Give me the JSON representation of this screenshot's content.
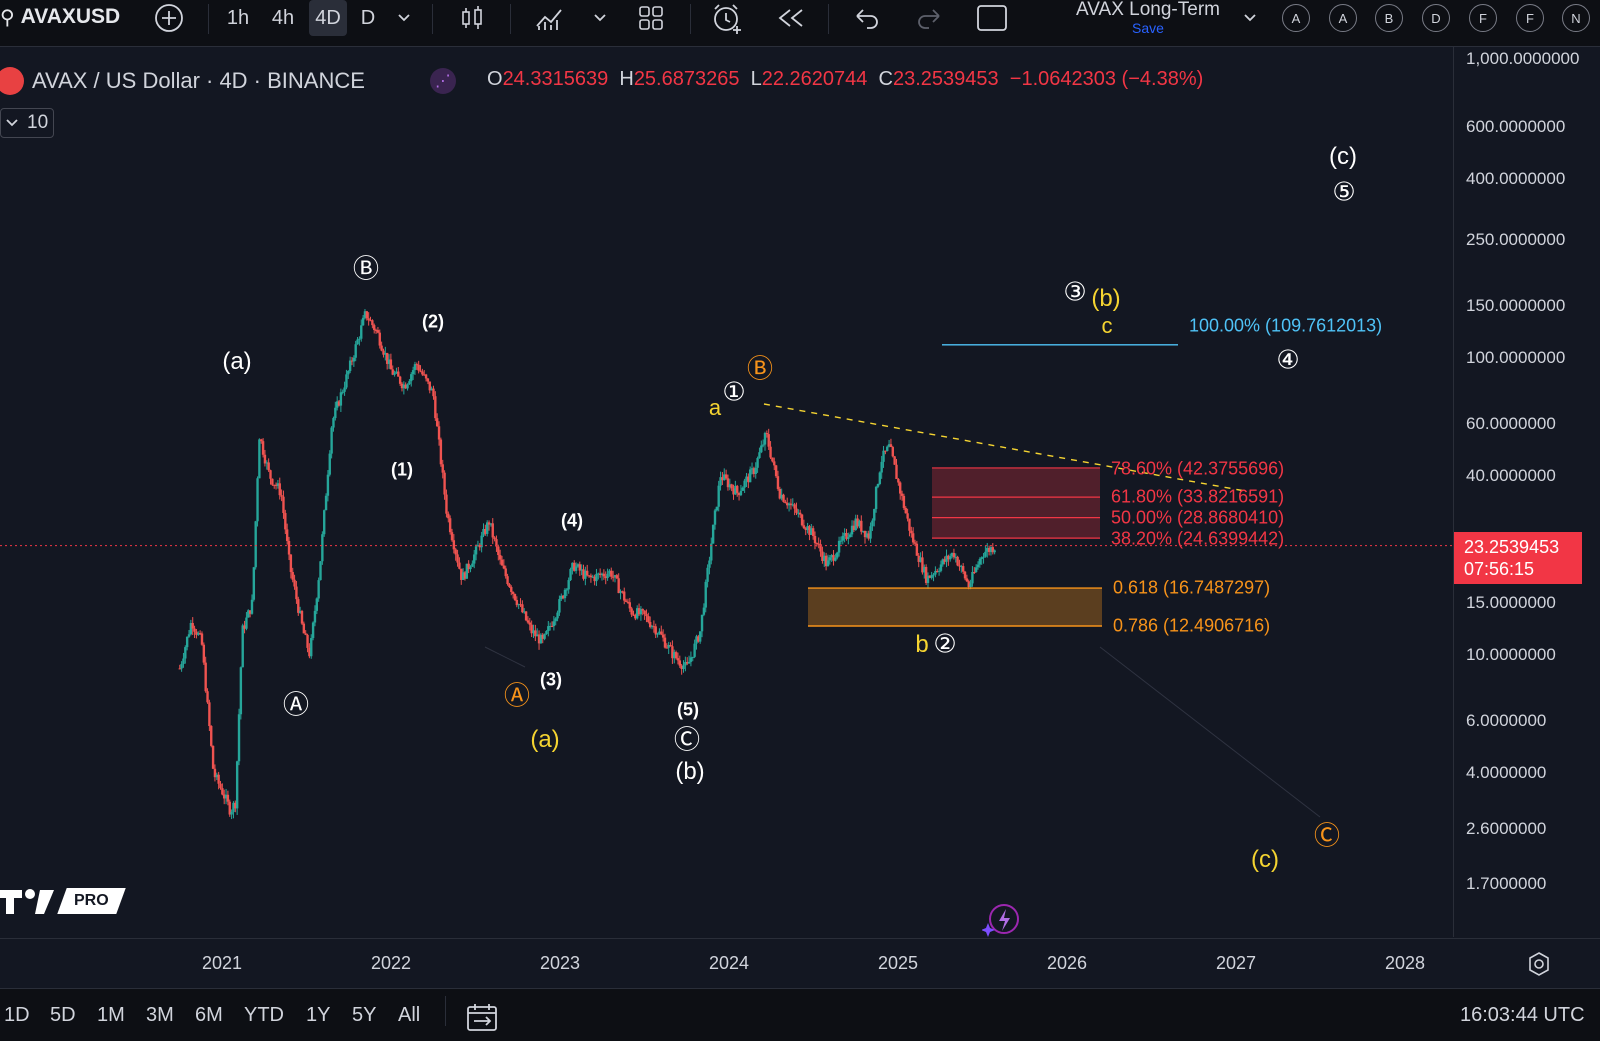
{
  "toolbar": {
    "symbol": "AVAXUSD",
    "intervals": [
      "1h",
      "4h",
      "4D",
      "D"
    ],
    "selected_interval": "4D",
    "layout_name": "AVAX Long-Term",
    "save_label": "Save",
    "alert_letters": [
      "A",
      "A",
      "B",
      "D",
      "F",
      "F",
      "N"
    ]
  },
  "legend": {
    "title": "AVAX / US Dollar · 4D · BINANCE",
    "o_label": "O",
    "o": "24.3315639",
    "h_label": "H",
    "h": "25.6873265",
    "l_label": "L",
    "l": "22.2620744",
    "c_label": "C",
    "c": "23.2539453",
    "change": "−1.0642303 (−4.38%)",
    "volume_indicator": "10"
  },
  "price_axis": {
    "labels": [
      "1,000.0000000",
      "600.0000000",
      "400.0000000",
      "250.0000000",
      "150.0000000",
      "100.0000000",
      "60.0000000",
      "40.0000000",
      "15.0000000",
      "10.0000000",
      "6.0000000",
      "4.0000000",
      "2.6000000",
      "1.7000000"
    ],
    "current_price": "23.2539453",
    "countdown": "07:56:15"
  },
  "time_axis": {
    "labels": [
      "2021",
      "2022",
      "2023",
      "2024",
      "2025",
      "2026",
      "2027",
      "2028"
    ]
  },
  "bottom_bar": {
    "ranges": [
      "1D",
      "5D",
      "1M",
      "3M",
      "6M",
      "YTD",
      "1Y",
      "5Y",
      "All"
    ],
    "clock": "16:03:44 UTC"
  },
  "fib_levels": {
    "upper": [
      "78.60% (42.3755696)",
      "61.80% (33.8216591)",
      "50.00% (28.8680410)",
      "38.20% (24.6399442)"
    ],
    "target": "100.00% (109.7612013)",
    "lower": [
      "0.618 (16.7487297)",
      "0.786 (12.4906716)"
    ]
  },
  "wave_labels": {
    "a_paren": "(a)",
    "B_circ": "Ⓑ",
    "w2": "(2)",
    "w1": "(1)",
    "w4": "(4)",
    "w3": "(3)",
    "w5": "(5)",
    "A_circ": "Ⓐ",
    "A_orange": "Ⓐ",
    "a_yellow": "(a)",
    "C_circ": "Ⓒ",
    "b_paren": "(b)",
    "a_small": "a",
    "one_circ": "①",
    "B_orange": "Ⓑ",
    "three_circ": "③",
    "b_yellow": "(b)",
    "c_small": "c",
    "b_small": "b",
    "two_circ": "②",
    "c_paren_white": "(c)",
    "five_circ": "⑤",
    "four_circ": "④",
    "C_orange": "Ⓒ",
    "c_yellow": "(c)"
  },
  "branding": {
    "pro_label": "PRO"
  },
  "colors": {
    "background": "#131722",
    "candle_up": "#26a69a",
    "candle_down": "#ef5350",
    "fib_upper": "#f23645",
    "fib_lower": "#f7931a",
    "target_line": "#4fc3f7",
    "wave_white": "#ffffff",
    "wave_yellow": "#f5d431",
    "wave_orange": "#f7931a"
  },
  "chart_data": {
    "type": "candlestick",
    "ylim": [
      1.2,
      1000
    ],
    "scale": "log",
    "xlim": [
      2020.0,
      2028.5
    ],
    "price_path": [
      [
        2020.75,
        9.0
      ],
      [
        2020.82,
        13.0
      ],
      [
        2020.88,
        11.0
      ],
      [
        2020.95,
        4.0
      ],
      [
        2021.0,
        3.5
      ],
      [
        2021.05,
        3.0
      ],
      [
        2021.08,
        3.2
      ],
      [
        2021.12,
        12.0
      ],
      [
        2021.18,
        15.0
      ],
      [
        2021.22,
        55.0
      ],
      [
        2021.28,
        40.0
      ],
      [
        2021.35,
        35.0
      ],
      [
        2021.4,
        20.0
      ],
      [
        2021.48,
        12.0
      ],
      [
        2021.52,
        10.0
      ],
      [
        2021.58,
        20.0
      ],
      [
        2021.65,
        60.0
      ],
      [
        2021.75,
        90.0
      ],
      [
        2021.85,
        140.0
      ],
      [
        2021.92,
        120.0
      ],
      [
        2022.0,
        90.0
      ],
      [
        2022.08,
        80.0
      ],
      [
        2022.15,
        95.0
      ],
      [
        2022.25,
        75.0
      ],
      [
        2022.33,
        30.0
      ],
      [
        2022.42,
        18.0
      ],
      [
        2022.5,
        22.0
      ],
      [
        2022.58,
        28.0
      ],
      [
        2022.65,
        20.0
      ],
      [
        2022.75,
        15.0
      ],
      [
        2022.83,
        12.0
      ],
      [
        2022.9,
        11.0
      ],
      [
        2023.0,
        15.0
      ],
      [
        2023.08,
        20.0
      ],
      [
        2023.17,
        18.0
      ],
      [
        2023.3,
        19.0
      ],
      [
        2023.42,
        14.0
      ],
      [
        2023.5,
        13.5
      ],
      [
        2023.58,
        12.0
      ],
      [
        2023.67,
        10.0
      ],
      [
        2023.75,
        9.0
      ],
      [
        2023.83,
        12.0
      ],
      [
        2023.9,
        25.0
      ],
      [
        2023.95,
        40.0
      ],
      [
        2024.05,
        35.0
      ],
      [
        2024.15,
        42.0
      ],
      [
        2024.22,
        55.0
      ],
      [
        2024.3,
        35.0
      ],
      [
        2024.4,
        30.0
      ],
      [
        2024.5,
        25.0
      ],
      [
        2024.58,
        20.0
      ],
      [
        2024.67,
        24.0
      ],
      [
        2024.75,
        28.0
      ],
      [
        2024.83,
        25.0
      ],
      [
        2024.9,
        45.0
      ],
      [
        2024.95,
        50.0
      ],
      [
        2025.0,
        38.0
      ],
      [
        2025.08,
        25.0
      ],
      [
        2025.17,
        18.0
      ],
      [
        2025.25,
        20.0
      ],
      [
        2025.33,
        22.0
      ],
      [
        2025.42,
        17.0
      ],
      [
        2025.5,
        22.0
      ],
      [
        2025.58,
        23.25
      ]
    ],
    "fib_upper_levels": [
      42.3755696,
      33.8216591,
      28.868041,
      24.6399442
    ],
    "fib_lower_levels": [
      16.7487297,
      12.4906716
    ],
    "target_level": 109.7612013,
    "current_price": 23.2539453
  }
}
